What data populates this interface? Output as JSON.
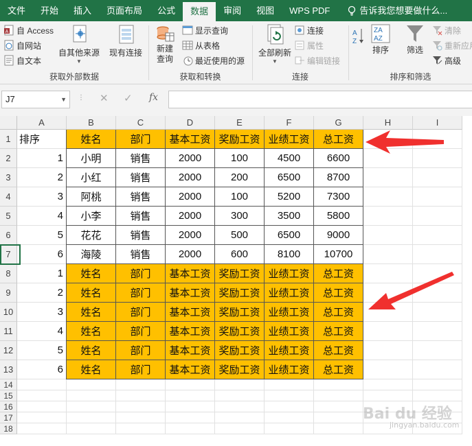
{
  "tabs": [
    {
      "label": "文件",
      "active": false
    },
    {
      "label": "开始",
      "active": false
    },
    {
      "label": "插入",
      "active": false
    },
    {
      "label": "页面布局",
      "active": false
    },
    {
      "label": "公式",
      "active": false
    },
    {
      "label": "数据",
      "active": true
    },
    {
      "label": "审阅",
      "active": false
    },
    {
      "label": "视图",
      "active": false
    },
    {
      "label": "WPS PDF",
      "active": false
    }
  ],
  "tell_me": "告诉我您想要做什么...",
  "ribbon": {
    "get_external": {
      "label": "获取外部数据",
      "access": "自 Access",
      "web": "自网站",
      "text": "自文本",
      "other": "自其他来源",
      "existing": "现有连接"
    },
    "get_transform": {
      "label": "获取和转换",
      "new_query": "新建\n查询",
      "show_queries": "显示查询",
      "from_table": "从表格",
      "recent_sources": "最近使用的源"
    },
    "connections": {
      "label": "连接",
      "refresh_all": "全部刷新",
      "connections": "连接",
      "properties": "属性",
      "edit_links": "编辑链接"
    },
    "sort_filter": {
      "label": "排序和筛选",
      "sort": "排序",
      "filter": "筛选",
      "clear": "清除",
      "reapply": "重新应用",
      "advanced": "高级"
    }
  },
  "formula_bar": {
    "name_box": "J7",
    "formula": ""
  },
  "grid": {
    "columns": [
      "A",
      "B",
      "C",
      "D",
      "E",
      "F",
      "G",
      "H",
      "I"
    ],
    "rows": [
      [
        "排序",
        "姓名",
        "部门",
        "基本工资",
        "奖励工资",
        "业绩工资",
        "总工资"
      ],
      [
        "1",
        "小明",
        "销售",
        "2000",
        "100",
        "4500",
        "6600"
      ],
      [
        "2",
        "小红",
        "销售",
        "2000",
        "200",
        "6500",
        "8700"
      ],
      [
        "3",
        "阿桃",
        "销售",
        "2000",
        "100",
        "5200",
        "7300"
      ],
      [
        "4",
        "小李",
        "销售",
        "2000",
        "300",
        "3500",
        "5800"
      ],
      [
        "5",
        "花花",
        "销售",
        "2000",
        "500",
        "6500",
        "9000"
      ],
      [
        "6",
        "海陵",
        "销售",
        "2000",
        "600",
        "8100",
        "10700"
      ],
      [
        "1",
        "姓名",
        "部门",
        "基本工资",
        "奖励工资",
        "业绩工资",
        "总工资"
      ],
      [
        "2",
        "姓名",
        "部门",
        "基本工资",
        "奖励工资",
        "业绩工资",
        "总工资"
      ],
      [
        "3",
        "姓名",
        "部门",
        "基本工资",
        "奖励工资",
        "业绩工资",
        "总工资"
      ],
      [
        "4",
        "姓名",
        "部门",
        "基本工资",
        "奖励工资",
        "业绩工资",
        "总工资"
      ],
      [
        "5",
        "姓名",
        "部门",
        "基本工资",
        "奖励工资",
        "业绩工资",
        "总工资"
      ],
      [
        "6",
        "姓名",
        "部门",
        "基本工资",
        "奖励工资",
        "业绩工资",
        "总工资"
      ]
    ],
    "row_numbers": [
      "1",
      "2",
      "3",
      "4",
      "5",
      "6",
      "7",
      "8",
      "9",
      "10",
      "11",
      "12",
      "13",
      "14",
      "15",
      "16",
      "17",
      "18"
    ],
    "highlight_color": "#ffc000",
    "selected_cell": "J7"
  },
  "annotation_color": "#f0302e",
  "watermark": {
    "brand": "Bai du 经验",
    "url": "jingyan.baidu.com"
  }
}
